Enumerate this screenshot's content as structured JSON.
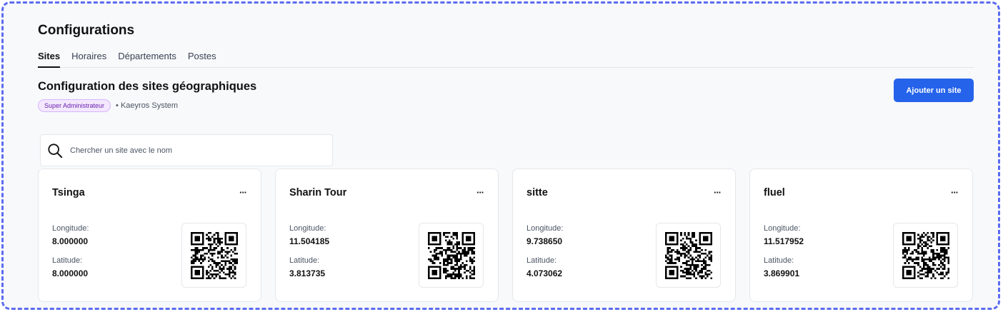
{
  "page": {
    "title": "Configurations"
  },
  "tabs": [
    {
      "label": "Sites",
      "active": true
    },
    {
      "label": "Horaires",
      "active": false
    },
    {
      "label": "Départements",
      "active": false
    },
    {
      "label": "Postes",
      "active": false
    }
  ],
  "section": {
    "title": "Configuration des sites géographiques",
    "role_badge": "Super Administrateur",
    "organization": "• Kaeyros System",
    "add_button": "Ajouter un site"
  },
  "search": {
    "placeholder": "Chercher un site avec le nom",
    "value": ""
  },
  "sites": [
    {
      "name": "Tsinga",
      "longitude_label": "Longitude:",
      "longitude": "8.000000",
      "latitude_label": "Latitude:",
      "latitude": "8.000000",
      "menu": "···"
    },
    {
      "name": "Sharin Tour",
      "longitude_label": "Longitude:",
      "longitude": "11.504185",
      "latitude_label": "Latitude:",
      "latitude": "3.813735",
      "menu": "···"
    },
    {
      "name": "sitte",
      "longitude_label": "Longitude:",
      "longitude": "9.738650",
      "latitude_label": "Latitude:",
      "latitude": "4.073062",
      "menu": "···"
    },
    {
      "name": "fluel",
      "longitude_label": "Longitude:",
      "longitude": "11.517952",
      "latitude_label": "Latitude:",
      "latitude": "3.869901",
      "menu": "···"
    }
  ],
  "colors": {
    "accent": "#2563eb",
    "frame_border": "#5b6cf0",
    "badge_bg": "#f3e8ff",
    "badge_text": "#6b21a8"
  },
  "icons": {
    "search": "search-icon",
    "menu": "more-horizontal-icon",
    "qr": "qr-code-icon"
  }
}
